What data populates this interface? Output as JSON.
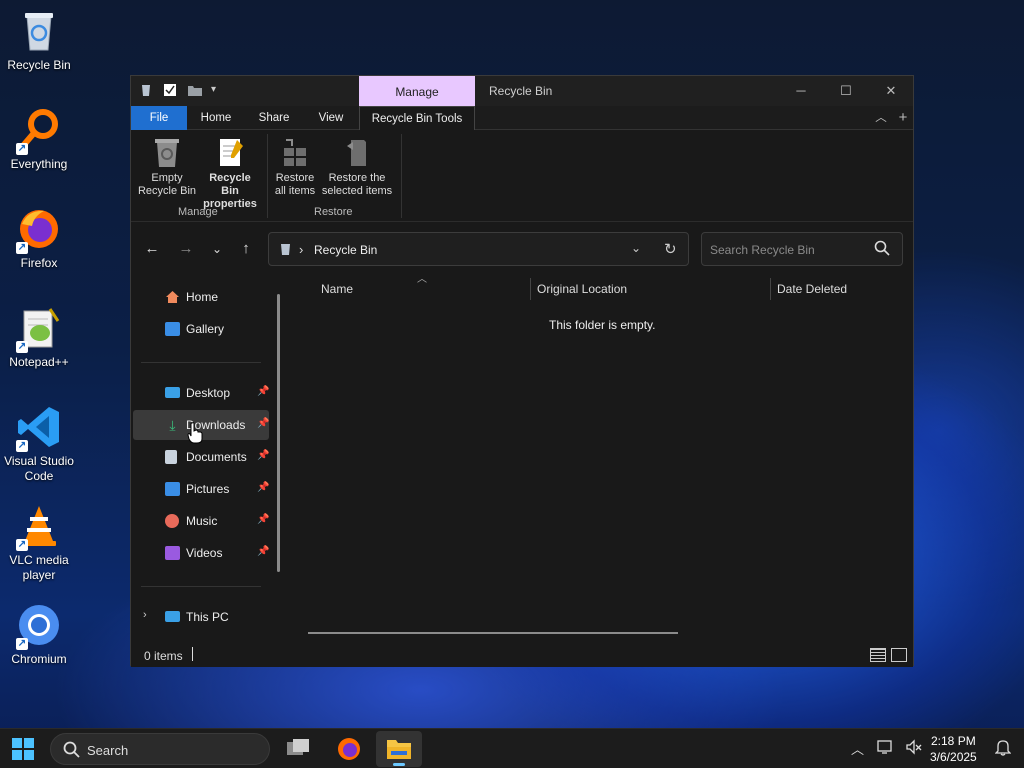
{
  "desktop": {
    "icons": [
      {
        "label": "Recycle Bin",
        "icon": "recycle-bin-icon"
      },
      {
        "label": "Everything",
        "icon": "everything-search-icon"
      },
      {
        "label": "Firefox",
        "icon": "firefox-icon"
      },
      {
        "label": "Notepad++",
        "icon": "notepad-plus-plus-icon"
      },
      {
        "label": "Visual Studio Code",
        "icon": "vscode-icon"
      },
      {
        "label": "VLC media player",
        "icon": "vlc-icon"
      },
      {
        "label": "Chromium",
        "icon": "chromium-icon"
      }
    ]
  },
  "window": {
    "context_tab": "Manage",
    "title": "Recycle Bin",
    "ribbon_tabs": [
      "File",
      "Home",
      "Share",
      "View",
      "Recycle Bin Tools"
    ],
    "ribbon_buttons": {
      "empty": "Empty\nRecycle Bin",
      "empty_line1": "Empty",
      "empty_line2": "Recycle Bin",
      "props_line1": "Recycle Bin",
      "props_line2": "properties",
      "restore_all_line1": "Restore",
      "restore_all_line2": "all items",
      "restore_sel_line1": "Restore the",
      "restore_sel_line2": "selected items"
    },
    "ribbon_groups": {
      "manage": "Manage",
      "restore": "Restore"
    },
    "address": {
      "breadcrumb_sep": "›",
      "path": "Recycle Bin"
    },
    "search": {
      "placeholder": "Search Recycle Bin"
    },
    "sidebar": {
      "items": [
        {
          "label": "Home"
        },
        {
          "label": "Gallery"
        },
        {
          "label": "Desktop"
        },
        {
          "label": "Downloads"
        },
        {
          "label": "Documents"
        },
        {
          "label": "Pictures"
        },
        {
          "label": "Music"
        },
        {
          "label": "Videos"
        },
        {
          "label": "This PC"
        }
      ],
      "selected": "Downloads"
    },
    "columns": [
      "Name",
      "Original Location",
      "Date Deleted"
    ],
    "empty_message": "This folder is empty.",
    "status": {
      "items": "0 items"
    }
  },
  "taskbar": {
    "search_label": "Search",
    "clock_time": "2:18 PM",
    "clock_date": "3/6/2025",
    "accent": "#4cc2ff"
  },
  "colors": {
    "file_tab": "#1f6fd0",
    "manage_tab": "#e8c8ff",
    "window_bg": "#191919"
  }
}
